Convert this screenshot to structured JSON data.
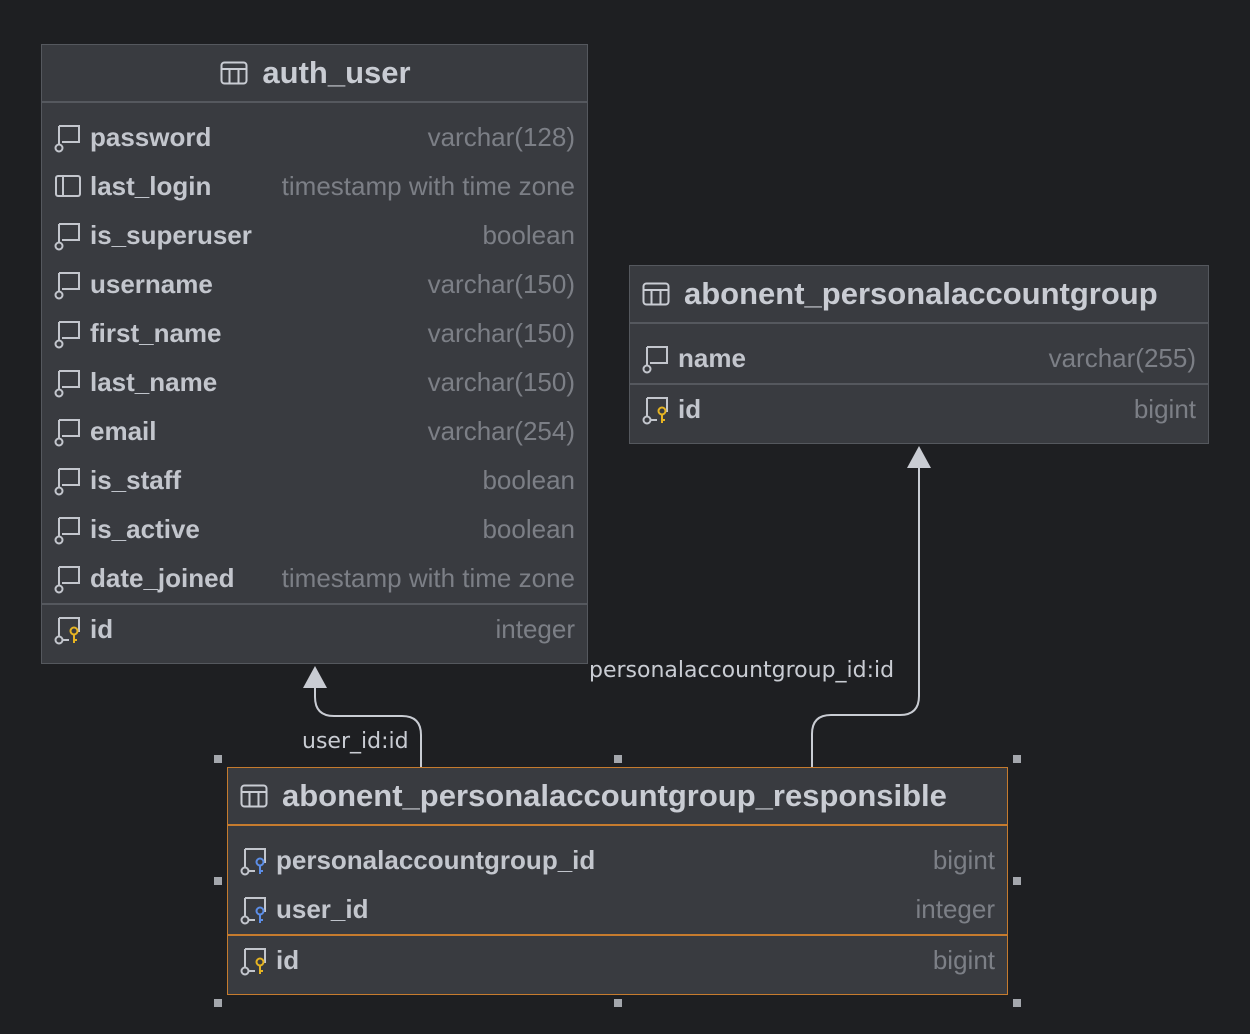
{
  "tables": {
    "auth_user": {
      "name": "auth_user",
      "columns": [
        {
          "name": "password",
          "type": "varchar(128)"
        },
        {
          "name": "last_login",
          "type": "timestamp with time zone"
        },
        {
          "name": "is_superuser",
          "type": "boolean"
        },
        {
          "name": "username",
          "type": "varchar(150)"
        },
        {
          "name": "first_name",
          "type": "varchar(150)"
        },
        {
          "name": "last_name",
          "type": "varchar(150)"
        },
        {
          "name": "email",
          "type": "varchar(254)"
        },
        {
          "name": "is_staff",
          "type": "boolean"
        },
        {
          "name": "is_active",
          "type": "boolean"
        },
        {
          "name": "date_joined",
          "type": "timestamp with time zone"
        }
      ],
      "pk": {
        "name": "id",
        "type": "integer"
      }
    },
    "group": {
      "name": "abonent_personalaccountgroup",
      "columns": [
        {
          "name": "name",
          "type": "varchar(255)"
        }
      ],
      "pk": {
        "name": "id",
        "type": "bigint"
      }
    },
    "responsible": {
      "name": "abonent_personalaccountgroup_responsible",
      "columns": [
        {
          "name": "personalaccountgroup_id",
          "type": "bigint"
        },
        {
          "name": "user_id",
          "type": "integer"
        }
      ],
      "pk": {
        "name": "id",
        "type": "bigint"
      }
    }
  },
  "relations": {
    "user_label": "user_id:id",
    "group_label": "personalaccountgroup_id:id"
  },
  "colors": {
    "background": "#1e1f22",
    "table_fill": "#393b40",
    "selection": "#c67b2e",
    "pk_key": "#e6b422",
    "fk_key": "#5c8ee8"
  }
}
